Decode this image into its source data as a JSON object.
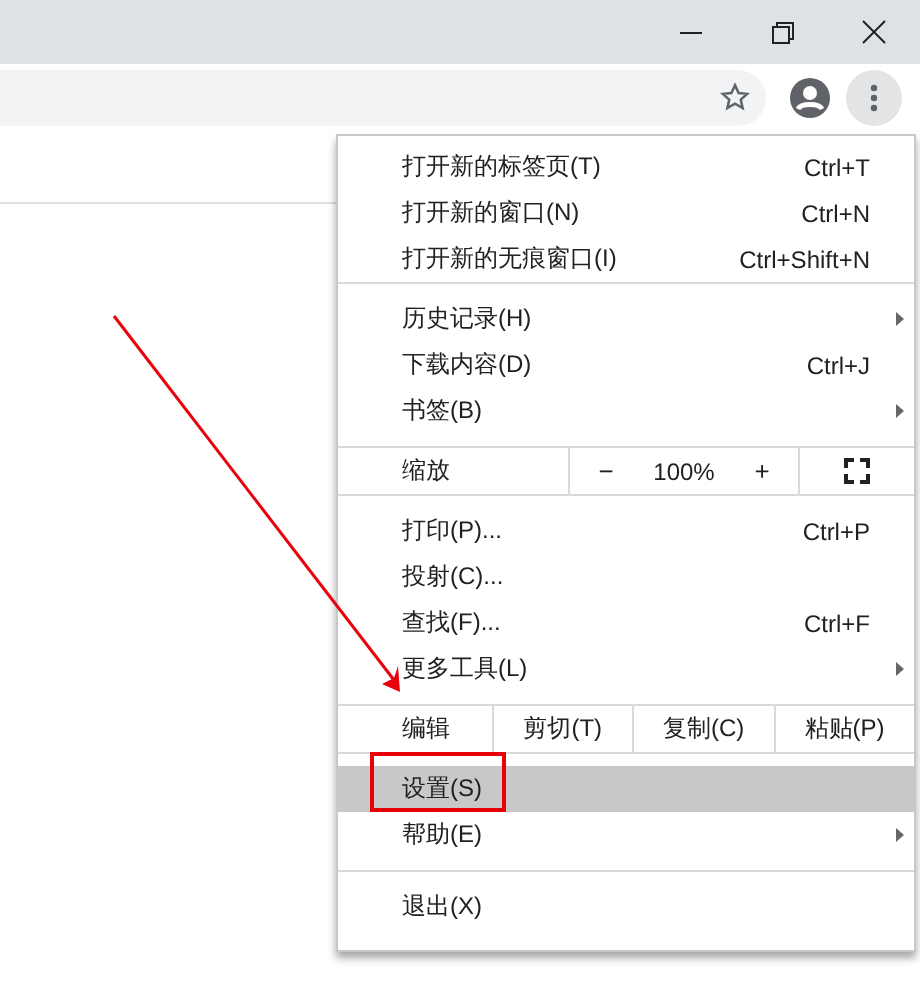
{
  "window": {
    "controls": [
      {
        "kind": "minimize"
      },
      {
        "kind": "restore"
      },
      {
        "kind": "close"
      }
    ]
  },
  "toolbar": {
    "menu_open": true
  },
  "menu": {
    "sections": [
      {
        "items": [
          {
            "kind": "item",
            "label": "打开新的标签页(T)",
            "shortcut": "Ctrl+T",
            "submenu": false,
            "selected": false
          },
          {
            "kind": "item",
            "label": "打开新的窗口(N)",
            "shortcut": "Ctrl+N",
            "submenu": false,
            "selected": false
          },
          {
            "kind": "item",
            "label": "打开新的无痕窗口(I)",
            "shortcut": "Ctrl+Shift+N",
            "submenu": false,
            "selected": false
          }
        ]
      },
      {
        "items": [
          {
            "kind": "item",
            "label": "历史记录(H)",
            "submenu": true,
            "selected": false
          },
          {
            "kind": "item",
            "label": "下载内容(D)",
            "shortcut": "Ctrl+J",
            "submenu": false,
            "selected": false
          },
          {
            "kind": "item",
            "label": "书签(B)",
            "submenu": true,
            "selected": false
          }
        ]
      },
      {
        "items": [
          {
            "kind": "zoom",
            "label": "缩放",
            "minus": "−",
            "value": "100%",
            "plus": "+"
          }
        ]
      },
      {
        "items": [
          {
            "kind": "item",
            "label": "打印(P)...",
            "shortcut": "Ctrl+P",
            "submenu": false,
            "selected": false
          },
          {
            "kind": "item",
            "label": "投射(C)...",
            "submenu": false,
            "selected": false
          },
          {
            "kind": "item",
            "label": "查找(F)...",
            "shortcut": "Ctrl+F",
            "submenu": false,
            "selected": false
          },
          {
            "kind": "item",
            "label": "更多工具(L)",
            "submenu": true,
            "selected": false
          }
        ]
      },
      {
        "items": [
          {
            "kind": "edit",
            "label": "编辑",
            "actions": [
              "剪切(T)",
              "复制(C)",
              "粘贴(P)"
            ]
          }
        ]
      },
      {
        "items": [
          {
            "kind": "item",
            "label": "设置(S)",
            "submenu": false,
            "selected": true
          },
          {
            "kind": "item",
            "label": "帮助(E)",
            "submenu": true,
            "selected": false
          }
        ]
      },
      {
        "items": [
          {
            "kind": "item",
            "label": "退出(X)",
            "submenu": false,
            "selected": false
          }
        ]
      }
    ]
  }
}
